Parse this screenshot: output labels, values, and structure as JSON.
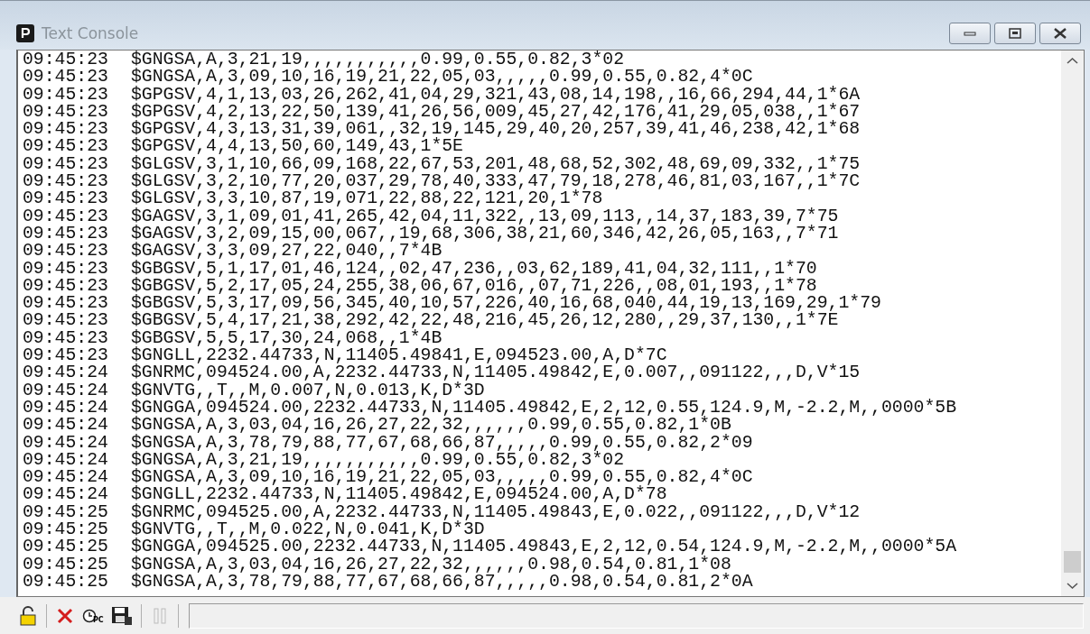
{
  "window": {
    "title": "Text Console"
  },
  "lines": [
    {
      "time": "09:45:23",
      "text": "$GNGSA,A,3,21,19,,,,,,,,,,,0.99,0.55,0.82,3*02"
    },
    {
      "time": "09:45:23",
      "text": "$GNGSA,A,3,09,10,16,19,21,22,05,03,,,,,0.99,0.55,0.82,4*0C"
    },
    {
      "time": "09:45:23",
      "text": "$GPGSV,4,1,13,03,26,262,41,04,29,321,43,08,14,198,,16,66,294,44,1*6A"
    },
    {
      "time": "09:45:23",
      "text": "$GPGSV,4,2,13,22,50,139,41,26,56,009,45,27,42,176,41,29,05,038,,1*67"
    },
    {
      "time": "09:45:23",
      "text": "$GPGSV,4,3,13,31,39,061,,32,19,145,29,40,20,257,39,41,46,238,42,1*68"
    },
    {
      "time": "09:45:23",
      "text": "$GPGSV,4,4,13,50,60,149,43,1*5E"
    },
    {
      "time": "09:45:23",
      "text": "$GLGSV,3,1,10,66,09,168,22,67,53,201,48,68,52,302,48,69,09,332,,1*75"
    },
    {
      "time": "09:45:23",
      "text": "$GLGSV,3,2,10,77,20,037,29,78,40,333,47,79,18,278,46,81,03,167,,1*7C"
    },
    {
      "time": "09:45:23",
      "text": "$GLGSV,3,3,10,87,19,071,22,88,22,121,20,1*78"
    },
    {
      "time": "09:45:23",
      "text": "$GAGSV,3,1,09,01,41,265,42,04,11,322,,13,09,113,,14,37,183,39,7*75"
    },
    {
      "time": "09:45:23",
      "text": "$GAGSV,3,2,09,15,00,067,,19,68,306,38,21,60,346,42,26,05,163,,7*71"
    },
    {
      "time": "09:45:23",
      "text": "$GAGSV,3,3,09,27,22,040,,7*4B"
    },
    {
      "time": "09:45:23",
      "text": "$GBGSV,5,1,17,01,46,124,,02,47,236,,03,62,189,41,04,32,111,,1*70"
    },
    {
      "time": "09:45:23",
      "text": "$GBGSV,5,2,17,05,24,255,38,06,67,016,,07,71,226,,08,01,193,,1*78"
    },
    {
      "time": "09:45:23",
      "text": "$GBGSV,5,3,17,09,56,345,40,10,57,226,40,16,68,040,44,19,13,169,29,1*79"
    },
    {
      "time": "09:45:23",
      "text": "$GBGSV,5,4,17,21,38,292,42,22,48,216,45,26,12,280,,29,37,130,,1*7E"
    },
    {
      "time": "09:45:23",
      "text": "$GBGSV,5,5,17,30,24,068,,1*4B"
    },
    {
      "time": "09:45:23",
      "text": "$GNGLL,2232.44733,N,11405.49841,E,094523.00,A,D*7C"
    },
    {
      "time": "09:45:24",
      "text": "$GNRMC,094524.00,A,2232.44733,N,11405.49842,E,0.007,,091122,,,D,V*15"
    },
    {
      "time": "09:45:24",
      "text": "$GNVTG,,T,,M,0.007,N,0.013,K,D*3D"
    },
    {
      "time": "09:45:24",
      "text": "$GNGGA,094524.00,2232.44733,N,11405.49842,E,2,12,0.55,124.9,M,-2.2,M,,0000*5B"
    },
    {
      "time": "09:45:24",
      "text": "$GNGSA,A,3,03,04,16,26,27,22,32,,,,,,0.99,0.55,0.82,1*0B"
    },
    {
      "time": "09:45:24",
      "text": "$GNGSA,A,3,78,79,88,77,67,68,66,87,,,,,0.99,0.55,0.82,2*09"
    },
    {
      "time": "09:45:24",
      "text": "$GNGSA,A,3,21,19,,,,,,,,,,,0.99,0.55,0.82,3*02"
    },
    {
      "time": "09:45:24",
      "text": "$GNGSA,A,3,09,10,16,19,21,22,05,03,,,,,0.99,0.55,0.82,4*0C"
    },
    {
      "time": "09:45:24",
      "text": "$GNGLL,2232.44733,N,11405.49842,E,094524.00,A,D*78"
    },
    {
      "time": "09:45:25",
      "text": "$GNRMC,094525.00,A,2232.44733,N,11405.49843,E,0.022,,091122,,,D,V*12"
    },
    {
      "time": "09:45:25",
      "text": "$GNVTG,,T,,M,0.022,N,0.041,K,D*3D"
    },
    {
      "time": "09:45:25",
      "text": "$GNGGA,094525.00,2232.44733,N,11405.49843,E,2,12,0.54,124.9,M,-2.2,M,,0000*5A"
    },
    {
      "time": "09:45:25",
      "text": "$GNGSA,A,3,03,04,16,26,27,22,32,,,,,,0.98,0.54,0.81,1*08"
    },
    {
      "time": "09:45:25",
      "text": "$GNGSA,A,3,78,79,88,77,67,68,66,87,,,,,0.98,0.54,0.81,2*0A"
    }
  ],
  "toolbar": [
    {
      "kind": "lock",
      "disabled": false
    },
    {
      "kind": "clear",
      "disabled": false
    },
    {
      "kind": "clock",
      "label": "PC",
      "disabled": false
    },
    {
      "kind": "save",
      "disabled": false
    },
    {
      "kind": "pause",
      "disabled": true
    }
  ]
}
